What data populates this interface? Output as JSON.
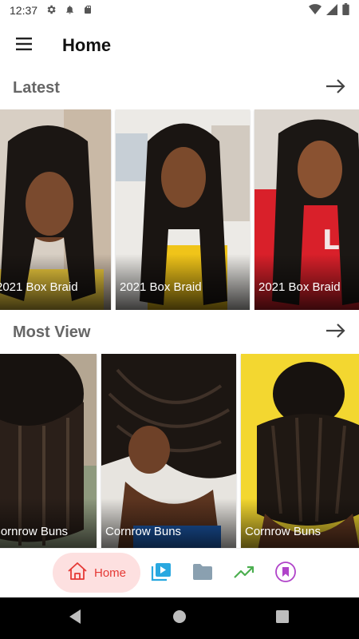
{
  "status_bar": {
    "time": "12:37"
  },
  "app_bar": {
    "title": "Home"
  },
  "sections": {
    "latest": {
      "title": "Latest",
      "items": [
        {
          "label": "2021 Box Braid"
        },
        {
          "label": "2021 Box Braid"
        },
        {
          "label": "2021 Box Braid"
        }
      ]
    },
    "most_view": {
      "title": "Most View",
      "items": [
        {
          "label": "Cornrow Buns"
        },
        {
          "label": "Cornrow Buns"
        },
        {
          "label": "Cornrow Buns"
        }
      ]
    }
  },
  "bottom_nav": {
    "home_label": "Home",
    "icons": [
      "home-icon",
      "video-library-icon",
      "folder-icon",
      "trending-icon",
      "bookmark-icon"
    ]
  },
  "colors": {
    "accent_red": "#e53935",
    "home_pill": "#fde0e0",
    "video_blue": "#29a8e0",
    "folder_grey": "#8aa0b0",
    "trend_green": "#4caf50",
    "bookmark_purple": "#b043c9"
  }
}
